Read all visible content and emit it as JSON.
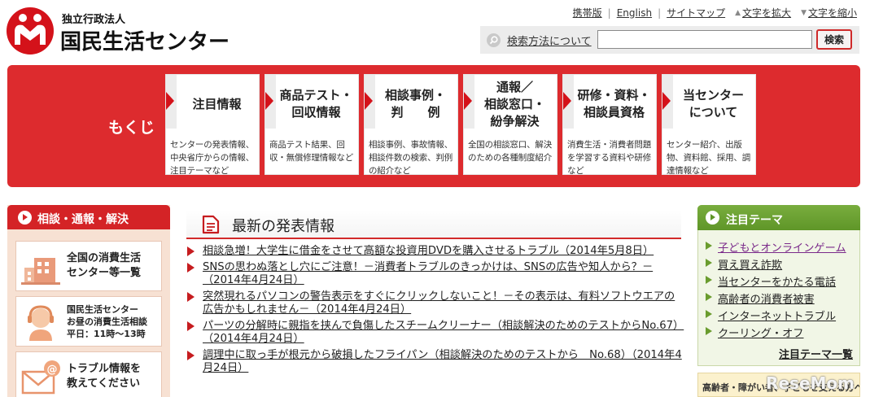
{
  "header": {
    "logo_sub": "独立行政法人",
    "logo_name": "国民生活センター",
    "util_links": [
      "携帯版",
      "English",
      "サイトマップ"
    ],
    "text_larger": "文字を拡大",
    "text_smaller": "文字を縮小",
    "search": {
      "how_to": "検索方法について",
      "value": "",
      "placeholder": "",
      "button": "検索"
    }
  },
  "menu": {
    "title": "もくじ",
    "items": [
      {
        "title": "注目情報",
        "desc": "センターの発表情報、中央省庁からの情報、注目テーマなど"
      },
      {
        "title": "商品テスト・\n回収情報",
        "desc": "商品テスト結果、回収・無償修理情報など"
      },
      {
        "title": "相談事例・\n判　　例",
        "desc": "相談事例、事故情報、相談件数の検索、判例の紹介など"
      },
      {
        "title": "通報／\n相談窓口・\n紛争解決",
        "desc": "全国の相談窓口、解決のための各種制度紹介"
      },
      {
        "title": "研修・資料・\n相談員資格",
        "desc": "消費生活・消費者問題を学習する資料や研修など"
      },
      {
        "title": "当センター\nについて",
        "desc": "センター紹介、出版物、資料館、採用、調達情報など"
      }
    ]
  },
  "left": {
    "heading": "相談・通報・解決",
    "boxes": [
      {
        "lines": [
          "全国の消費生活",
          "センター等一覧"
        ]
      },
      {
        "lines": [
          "国民生活センター",
          "お昼の消費生活相談",
          "平日：11時～13時"
        ]
      },
      {
        "lines": [
          "トラブル情報を",
          "教えてください"
        ]
      }
    ]
  },
  "news": {
    "title": "最新の発表情報",
    "items": [
      "相談急増！大学生に借金をさせて高額な投資用DVDを購入させるトラブル（2014年5月8日）",
      "SNSの思わぬ落とし穴にご注意！－消費者トラブルのきっかけは、SNSの広告や知人から？－（2014年4月24日）",
      "突然現れるパソコンの警告表示をすぐにクリックしないこと！－その表示は、有料ソフトウエアの広告かもしれません－（2014年4月24日）",
      "パーツの分解時に親指を挟んで負傷したスチームクリーナー（相談解決のためのテストからNo.67）（2014年4月24日）",
      "調理中に取っ手が根元から破損したフライパン（相談解決のためのテストから　No.68）（2014年4月24日）"
    ]
  },
  "topics": {
    "heading": "注目テーマ",
    "items": [
      "子どもとオンラインゲーム",
      "買え買え詐欺",
      "当センターをかたる電話",
      "高齢者の消費者被害",
      "インターネットトラブル",
      "クーリング・オフ"
    ],
    "more": "注目テーマ一覧"
  },
  "banner": {
    "text": "高齢者・障がい者、子どもを支える方へ",
    "watermark": "ReseMom"
  },
  "colors": {
    "brand_red": "#dd2b2e",
    "topic_green": "#6a9c2e",
    "visited_link": "#7a2a8a"
  },
  "icons": {
    "search": "magnifier-icon",
    "headings": "circle-arrow-icon",
    "news": "document-icon"
  }
}
